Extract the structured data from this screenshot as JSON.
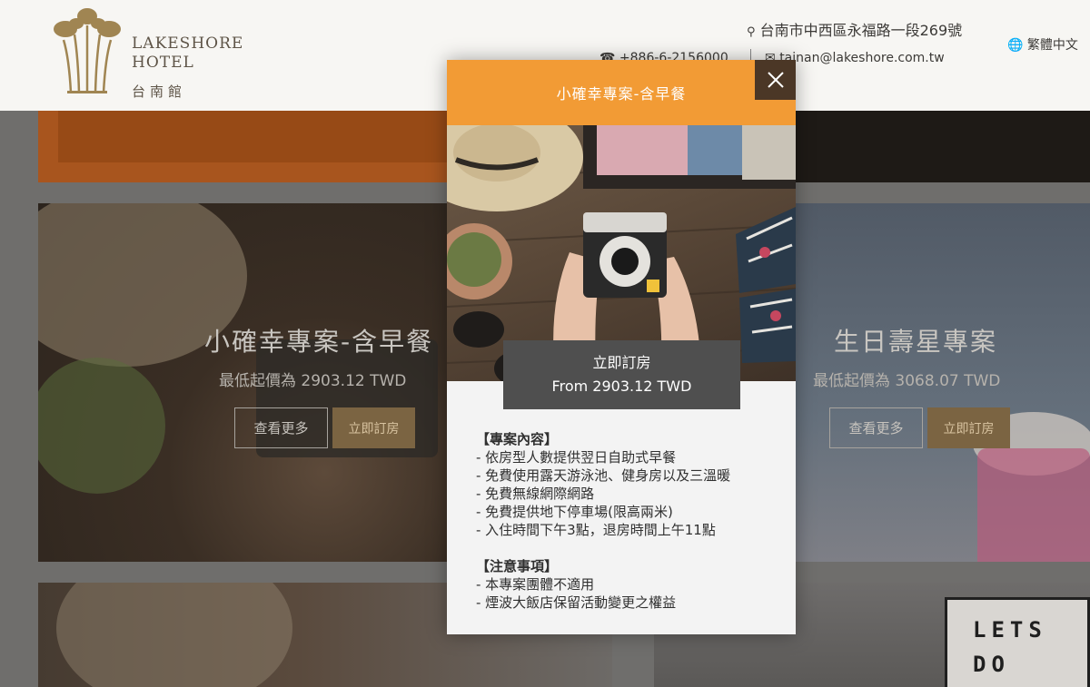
{
  "header": {
    "logo_name": "LAKESHORE\nHOTEL",
    "logo_branch": "台南館",
    "address": "台南市中西區永福路一段269號",
    "language": "繁體中文",
    "phone": "+886-6-2156000",
    "email": "tainan@lakeshore.com.tw"
  },
  "cards": [
    {
      "title": "小確幸專案-含早餐",
      "price": "最低起價為 2903.12 TWD",
      "more_label": "查看更多",
      "book_label": "立即訂房"
    },
    {
      "title": "生日壽星專案",
      "price": "最低起價為 3068.07 TWD",
      "more_label": "查看更多",
      "book_label": "立即訂房"
    }
  ],
  "bottom_card": {
    "lightbox_text": "LETS\nDO"
  },
  "modal": {
    "title": "小確幸專案-含早餐",
    "close_symbol": "×",
    "book_label": "立即訂房",
    "book_price": "From 2903.12 TWD",
    "content_heading": "【專案內容】",
    "content_items": [
      "- 依房型人數提供翌日自助式早餐",
      "- 免費使用露天游泳池、健身房以及三溫暖",
      "- 免費無線網際網路",
      "- 免費提供地下停車場(限高兩米)",
      "- 入住時間下午3點，退房時間上午11點"
    ],
    "notes_heading": "【注意事項】",
    "notes_items": [
      "- 本專案團體不適用",
      "- 煙波大飯店保留活動變更之權益"
    ]
  },
  "colors": {
    "modal_header": "#f29b35",
    "close_button": "#4b3726",
    "book_button": "#4f4f4f",
    "card_book_button": "#7b6442",
    "overlay": "#6f6e6c"
  },
  "icons": {
    "address": "map-pin-icon",
    "language": "globe-icon",
    "phone": "phone-icon",
    "email": "envelope-icon",
    "close": "close-icon"
  }
}
